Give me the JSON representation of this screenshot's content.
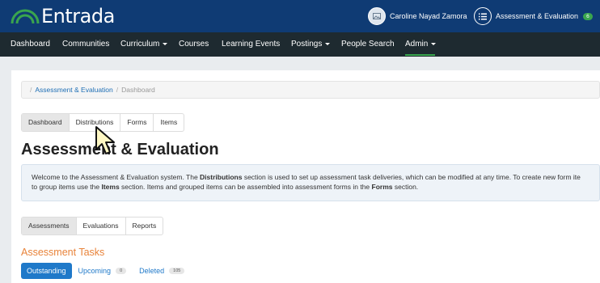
{
  "header": {
    "logo_text": "Entrada",
    "user_name": "Caroline Nayad Zamora",
    "module_label": "Assessment & Evaluation",
    "module_badge": "6"
  },
  "nav": {
    "dashboard": "Dashboard",
    "communities": "Communities",
    "curriculum": "Curriculum",
    "courses": "Courses",
    "learning_events": "Learning Events",
    "postings": "Postings",
    "people_search": "People Search",
    "admin": "Admin"
  },
  "breadcrumb": {
    "section": "Assessment & Evaluation",
    "current": "Dashboard"
  },
  "main_tabs": [
    "Dashboard",
    "Distributions",
    "Forms",
    "Items"
  ],
  "page_title": "Assessment & Evaluation",
  "welcome": {
    "line1_a": "Welcome to the Assessment & Evaluation system. The ",
    "line1_b": "Distributions",
    "line1_c": " section is used to set up assessment task deliveries, which can be modified at any time. To create new form ite",
    "line2_a": "to group items use the ",
    "line2_b": "Items",
    "line2_c": " section. Items and grouped items can be assembled into assessment forms in the ",
    "line2_d": "Forms",
    "line2_e": " section."
  },
  "sub_tabs": [
    "Assessments",
    "Evaluations",
    "Reports"
  ],
  "tasks": {
    "title": "Assessment Tasks",
    "outstanding": "Outstanding",
    "upcoming": "Upcoming",
    "upcoming_count": "0",
    "deleted": "Deleted",
    "deleted_count": "105"
  },
  "colors": {
    "header_bg": "#0f3b74",
    "nav_bg": "#1e2a30",
    "accent_green": "#3aa54e",
    "link_blue": "#1f79c9",
    "section_orange": "#e8833a"
  }
}
